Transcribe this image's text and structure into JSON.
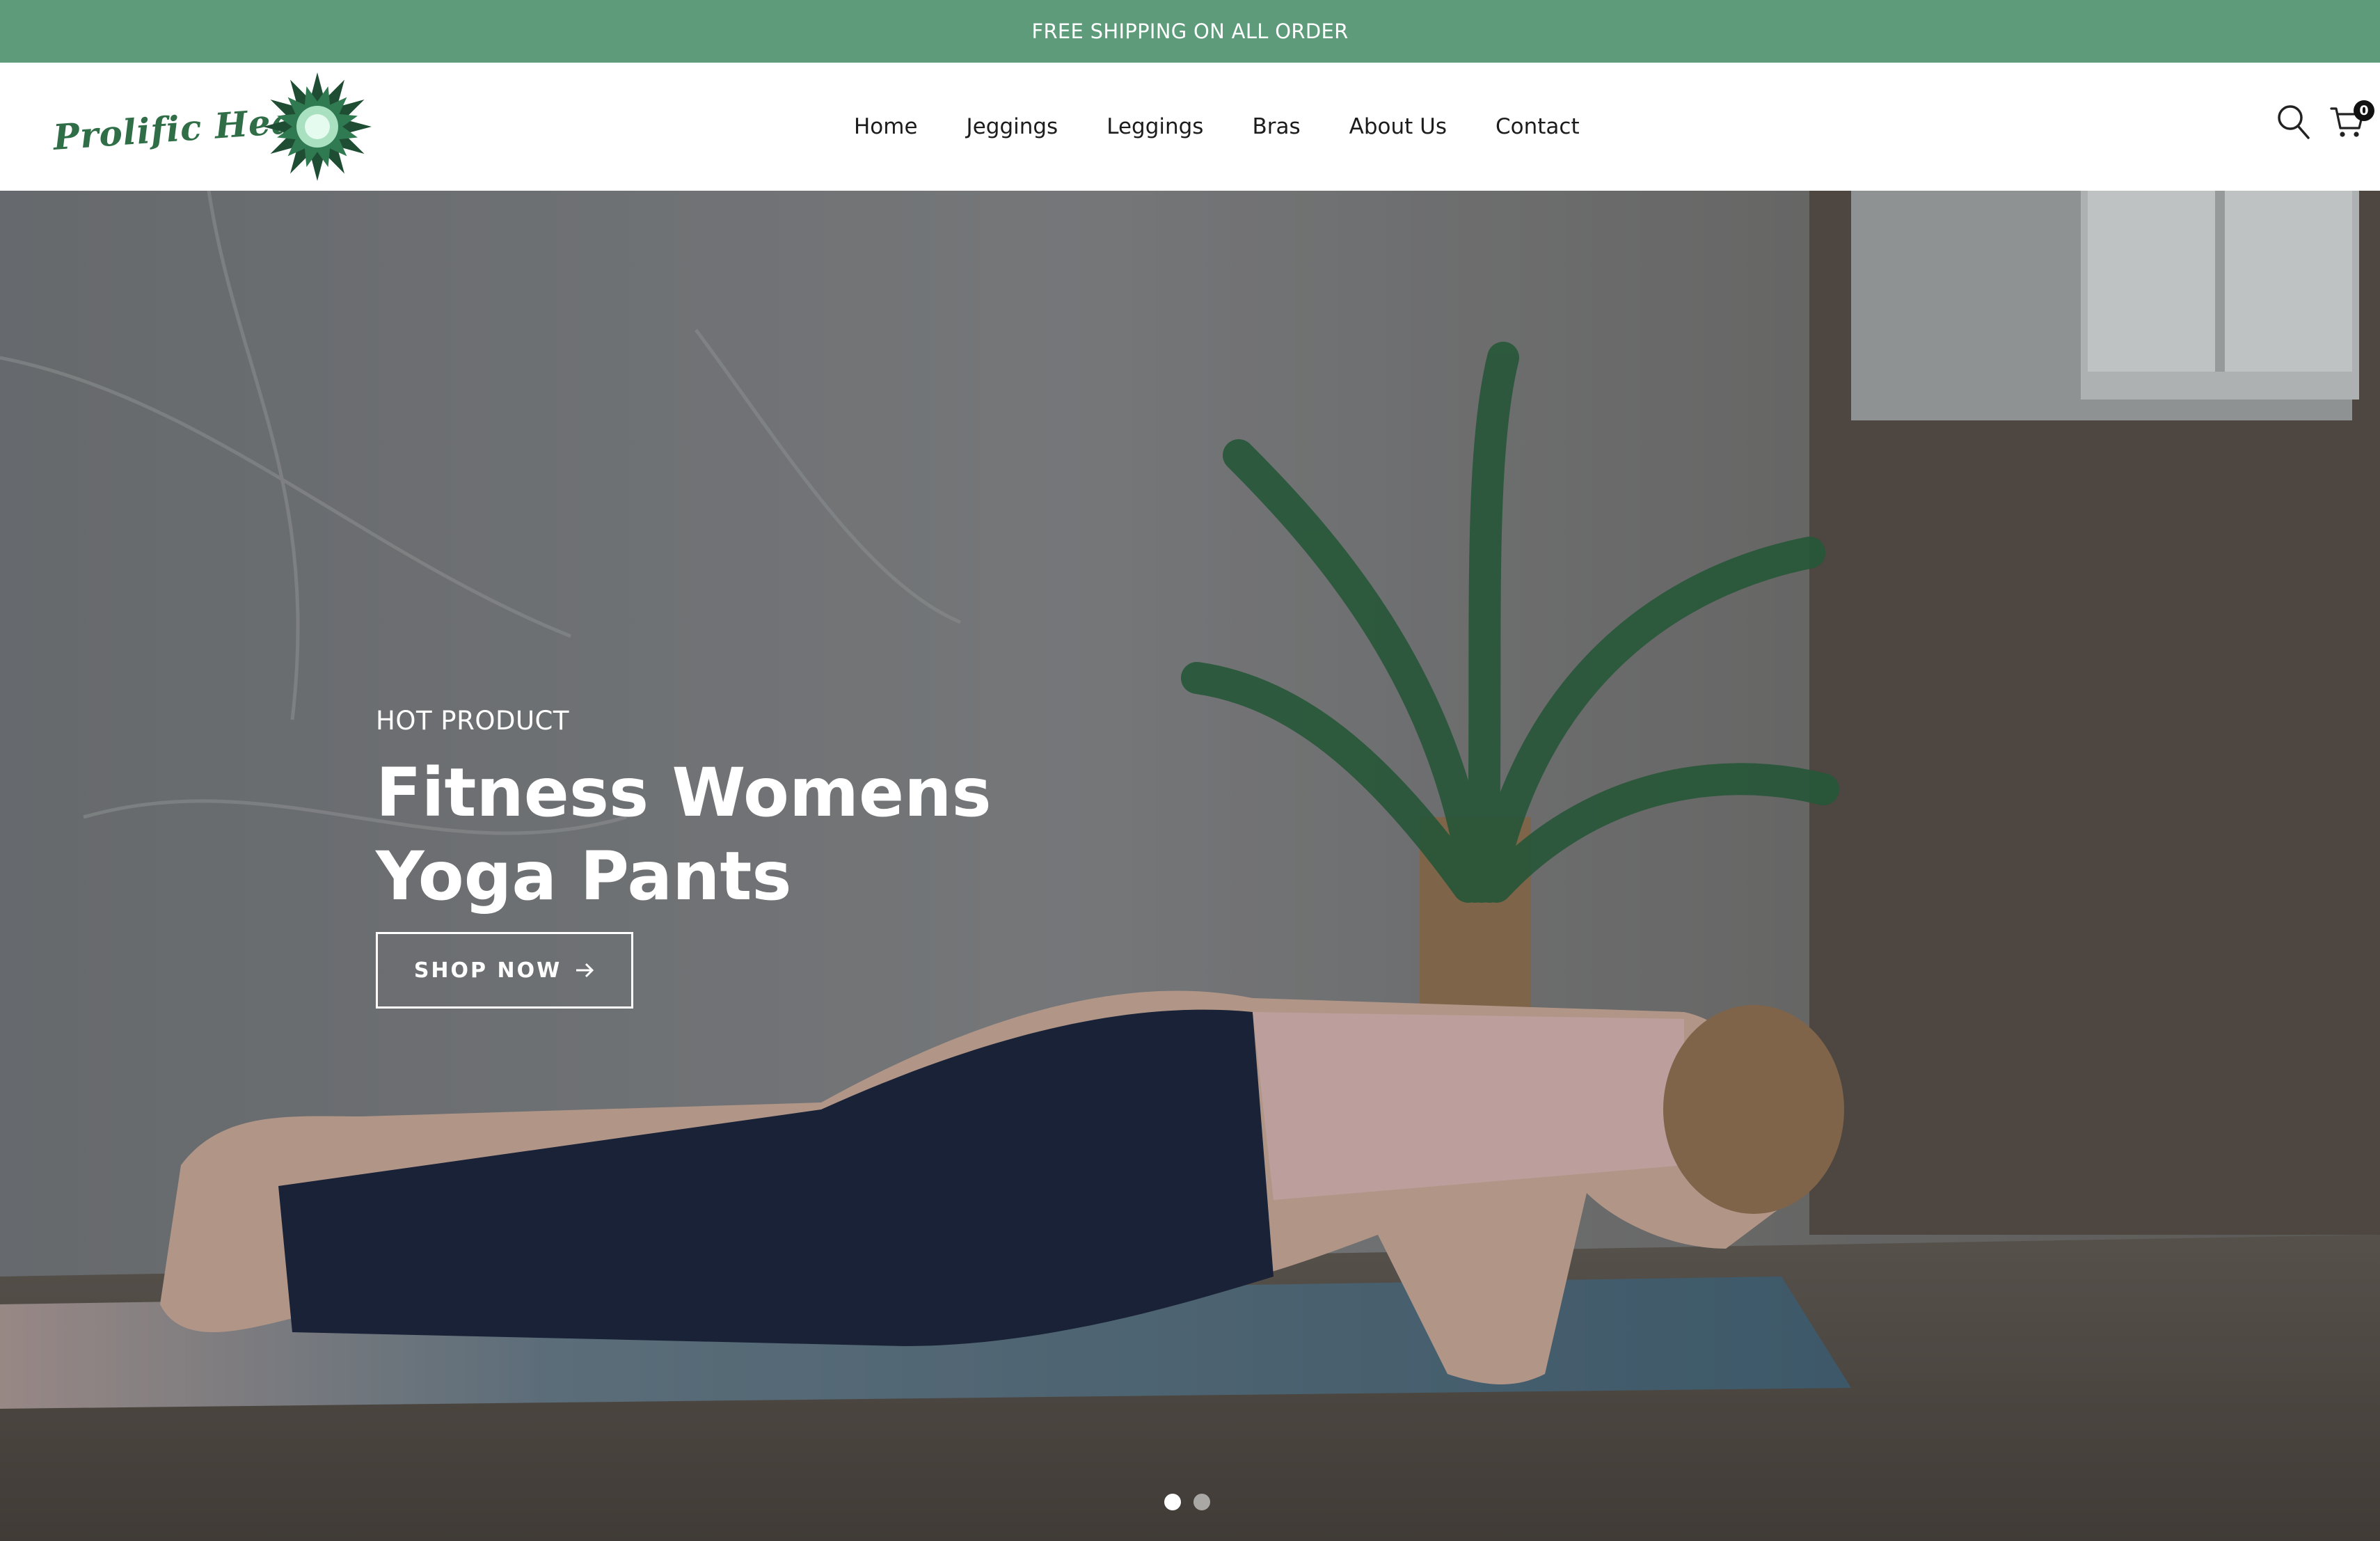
{
  "announcement": {
    "text": "FREE SHIPPING ON ALL ORDER"
  },
  "header": {
    "logo_text": "Prolific Health",
    "nav": [
      "Home",
      "Jeggings",
      "Leggings",
      "Bras",
      "About Us",
      "Contact"
    ],
    "cart_count": "0",
    "icons": {
      "search": "search-icon",
      "cart": "cart-icon"
    }
  },
  "hero": {
    "eyebrow": "HOT PRODUCT",
    "title_line1": "Fitness Womens",
    "title_line2": "Yoga Pants",
    "button_label": "SHOP NOW",
    "slides_total": 2,
    "active_slide": 1
  },
  "colors": {
    "announcement_bg": "#5e9b7a",
    "brand_green": "#2f6e46",
    "nav_text": "#1c1c1c",
    "hero_text": "#ffffff"
  }
}
